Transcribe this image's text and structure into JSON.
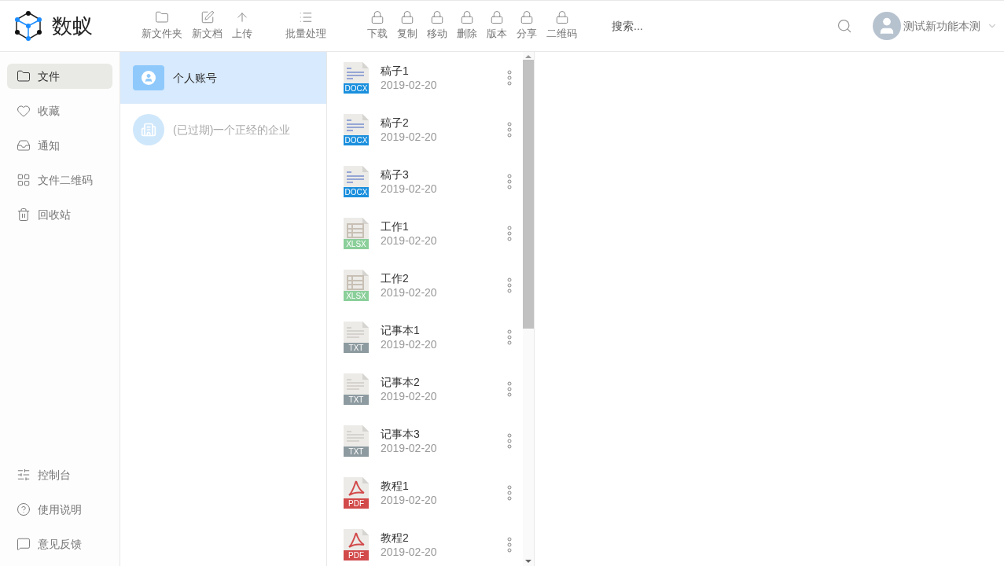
{
  "brand": {
    "name": "数蚁"
  },
  "toolbar": [
    {
      "label": "新文件夹",
      "kind": "folder"
    },
    {
      "label": "新文档",
      "kind": "edit"
    },
    {
      "label": "上传",
      "kind": "upload"
    },
    {
      "label": "批量处理",
      "kind": "list"
    },
    {
      "label": "下载",
      "kind": "lock"
    },
    {
      "label": "复制",
      "kind": "lock"
    },
    {
      "label": "移动",
      "kind": "lock"
    },
    {
      "label": "删除",
      "kind": "lock"
    },
    {
      "label": "版本",
      "kind": "lock"
    },
    {
      "label": "分享",
      "kind": "lock"
    },
    {
      "label": "二维码",
      "kind": "lock"
    }
  ],
  "search": {
    "placeholder": "搜索..."
  },
  "user": {
    "name": "测试新功能本测"
  },
  "sidebar": {
    "items": [
      {
        "label": "文件",
        "kind": "folder",
        "selected": true
      },
      {
        "label": "收藏",
        "kind": "heart",
        "selected": false
      },
      {
        "label": "通知",
        "kind": "inbox",
        "selected": false
      },
      {
        "label": "文件二维码",
        "kind": "qr",
        "selected": false
      },
      {
        "label": "回收站",
        "kind": "trash",
        "selected": false
      }
    ],
    "footer": [
      {
        "label": "控制台",
        "kind": "sliders"
      },
      {
        "label": "使用说明",
        "kind": "help"
      },
      {
        "label": "意见反馈",
        "kind": "chat"
      }
    ]
  },
  "accounts": [
    {
      "label": "个人账号",
      "kind": "personal",
      "selected": true,
      "disabled": false
    },
    {
      "label": "(已过期)一个正经的企业",
      "kind": "enterprise",
      "selected": false,
      "disabled": true
    }
  ],
  "files": [
    {
      "name": "稿子1",
      "date": "2019-02-20",
      "kind": "docx",
      "badge": "DOCX"
    },
    {
      "name": "稿子2",
      "date": "2019-02-20",
      "kind": "docx",
      "badge": "DOCX"
    },
    {
      "name": "稿子3",
      "date": "2019-02-20",
      "kind": "docx",
      "badge": "DOCX"
    },
    {
      "name": "工作1",
      "date": "2019-02-20",
      "kind": "xlsx",
      "badge": "XLSX"
    },
    {
      "name": "工作2",
      "date": "2019-02-20",
      "kind": "xlsx",
      "badge": "XLSX"
    },
    {
      "name": "记事本1",
      "date": "2019-02-20",
      "kind": "txt",
      "badge": "TXT"
    },
    {
      "name": "记事本2",
      "date": "2019-02-20",
      "kind": "txt",
      "badge": "TXT"
    },
    {
      "name": "记事本3",
      "date": "2019-02-20",
      "kind": "txt",
      "badge": "TXT"
    },
    {
      "name": "教程1",
      "date": "2019-02-20",
      "kind": "pdf",
      "badge": "PDF"
    },
    {
      "name": "教程2",
      "date": "2019-02-20",
      "kind": "pdf",
      "badge": "PDF"
    }
  ]
}
